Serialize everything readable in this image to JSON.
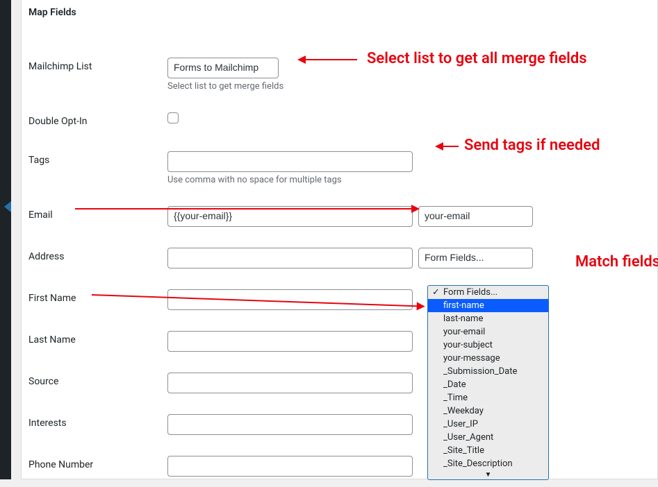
{
  "panel": {
    "title": "Map Fields"
  },
  "rows": {
    "mailchimp_list": {
      "label": "Mailchimp List",
      "selected": "Forms to Mailchimp",
      "description": "Select list to get merge fields"
    },
    "double_opt_in": {
      "label": "Double Opt-In"
    },
    "tags": {
      "label": "Tags",
      "value": "",
      "description": "Use comma with no space for multiple tags"
    },
    "email": {
      "label": "Email",
      "value": "{{your-email}}",
      "selected": "your-email"
    },
    "address": {
      "label": "Address",
      "value": "",
      "selected": "Form Fields..."
    },
    "first_name": {
      "label": "First Name",
      "value": ""
    },
    "last_name": {
      "label": "Last Name",
      "value": ""
    },
    "source": {
      "label": "Source",
      "value": ""
    },
    "interests": {
      "label": "Interests",
      "value": ""
    },
    "phone_number": {
      "label": "Phone Number",
      "value": ""
    }
  },
  "form_fields_dropdown": {
    "current": "Form Fields...",
    "highlighted": "first-name",
    "options": [
      "Form Fields...",
      "first-name",
      "last-name",
      "your-email",
      "your-subject",
      "your-message",
      "_Submission_Date",
      "_Date",
      "_Time",
      "_Weekday",
      "_User_IP",
      "_User_Agent",
      "_Site_Title",
      "_Site_Description"
    ]
  },
  "annotations": {
    "a1": "Select list to get all merge fields",
    "a2": "Send tags if needed",
    "a3": "Match fields"
  }
}
